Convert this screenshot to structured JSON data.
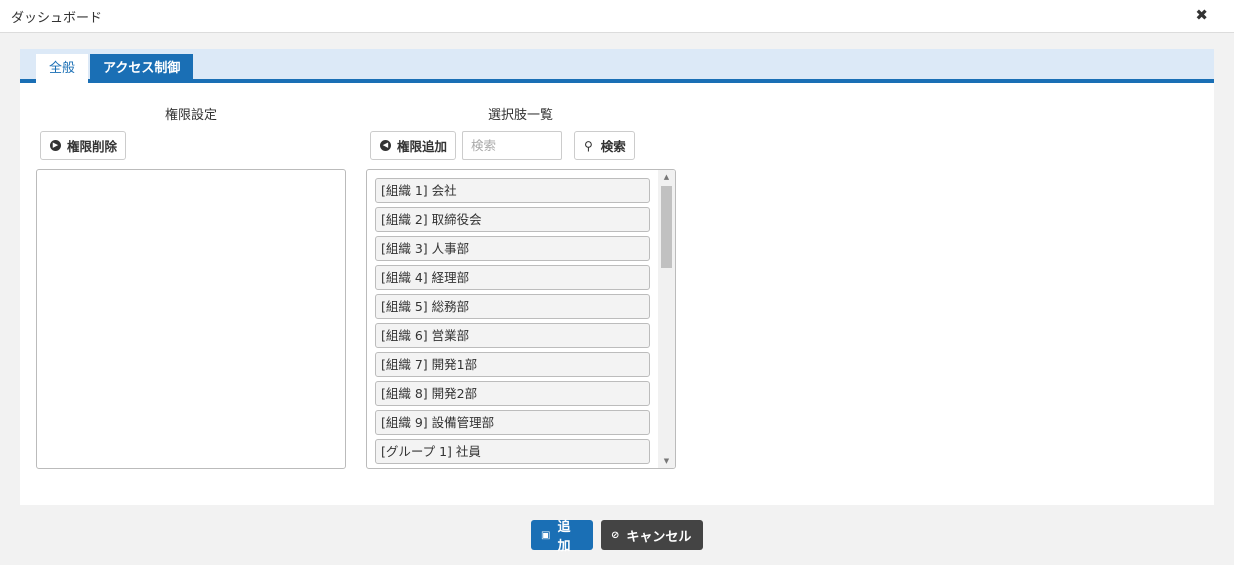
{
  "window": {
    "title": "ダッシュボード",
    "close_label": "✖"
  },
  "tabs": [
    {
      "label": "全般",
      "active": false
    },
    {
      "label": "アクセス制御",
      "active": true
    }
  ],
  "left": {
    "title": "権限設定",
    "remove_button": "権限削除"
  },
  "right": {
    "title": "選択肢一覧",
    "add_button": "権限追加",
    "search_placeholder": "検索",
    "search_value": "",
    "search_button": "検索",
    "options": [
      "[組織 1] 会社",
      "[組織 2] 取締役会",
      "[組織 3] 人事部",
      "[組織 4] 経理部",
      "[組織 5] 総務部",
      "[組織 6] 営業部",
      "[組織 7] 開発1部",
      "[組織 8] 開発2部",
      "[組織 9] 設備管理部",
      "[グループ 1] 社員"
    ]
  },
  "footer": {
    "add_button": "追加",
    "cancel_button": "キャンセル"
  },
  "colors": {
    "accent": "#1a6fb5",
    "tabbar_bg": "#dce9f7",
    "cancel_bg": "#444444",
    "page_bg": "#f2f2f2"
  },
  "icons": {
    "close": "close-icon",
    "remove": "circle-play-icon",
    "add": "circle-back-icon",
    "search": "search-icon",
    "save": "save-icon",
    "cancel": "ban-icon"
  }
}
